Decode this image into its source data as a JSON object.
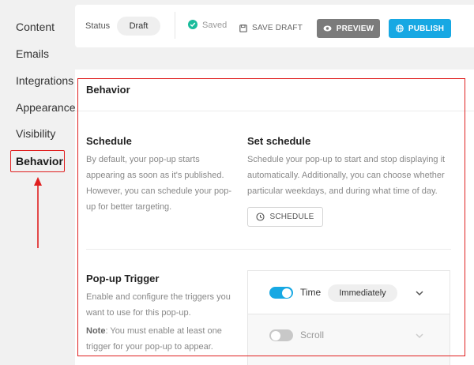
{
  "sidebar": {
    "items": [
      {
        "label": "Content"
      },
      {
        "label": "Emails"
      },
      {
        "label": "Integrations"
      },
      {
        "label": "Appearance"
      },
      {
        "label": "Visibility"
      },
      {
        "label": "Behavior",
        "active": true
      }
    ]
  },
  "topbar": {
    "status_label": "Status",
    "status_value": "Draft",
    "saved_text": "Saved",
    "save_draft_label": "SAVE DRAFT",
    "preview_label": "PREVIEW",
    "publish_label": "PUBLISH"
  },
  "panel": {
    "title": "Behavior",
    "schedule": {
      "heading": "Schedule",
      "description": "By default, your pop-up starts appearing as soon as it's published. However, you can schedule your pop-up for better targeting.",
      "set_heading": "Set schedule",
      "set_description": "Schedule your pop-up to start and stop displaying it automatically. Additionally, you can choose whether particular weekdays, and during what time of day.",
      "button_label": "SCHEDULE"
    },
    "trigger": {
      "heading": "Pop-up Trigger",
      "description": "Enable and configure the triggers you want to use for this pop-up.",
      "note_label": "Note",
      "note_text": ": You must enable at least one trigger for your pop-up to appear.",
      "items": [
        {
          "label": "Time",
          "enabled": true,
          "value": "Immediately"
        },
        {
          "label": "Scroll",
          "enabled": false
        }
      ]
    }
  },
  "colors": {
    "accent": "#17a8e3",
    "highlight": "#e02020",
    "saved": "#1abc9c",
    "preview_button": "#7b7b7b"
  },
  "icons": [
    "check-circle-icon",
    "floppy-disk-icon",
    "eye-icon",
    "globe-icon",
    "clock-icon",
    "chevron-down-icon",
    "red-arrow-annotation"
  ]
}
